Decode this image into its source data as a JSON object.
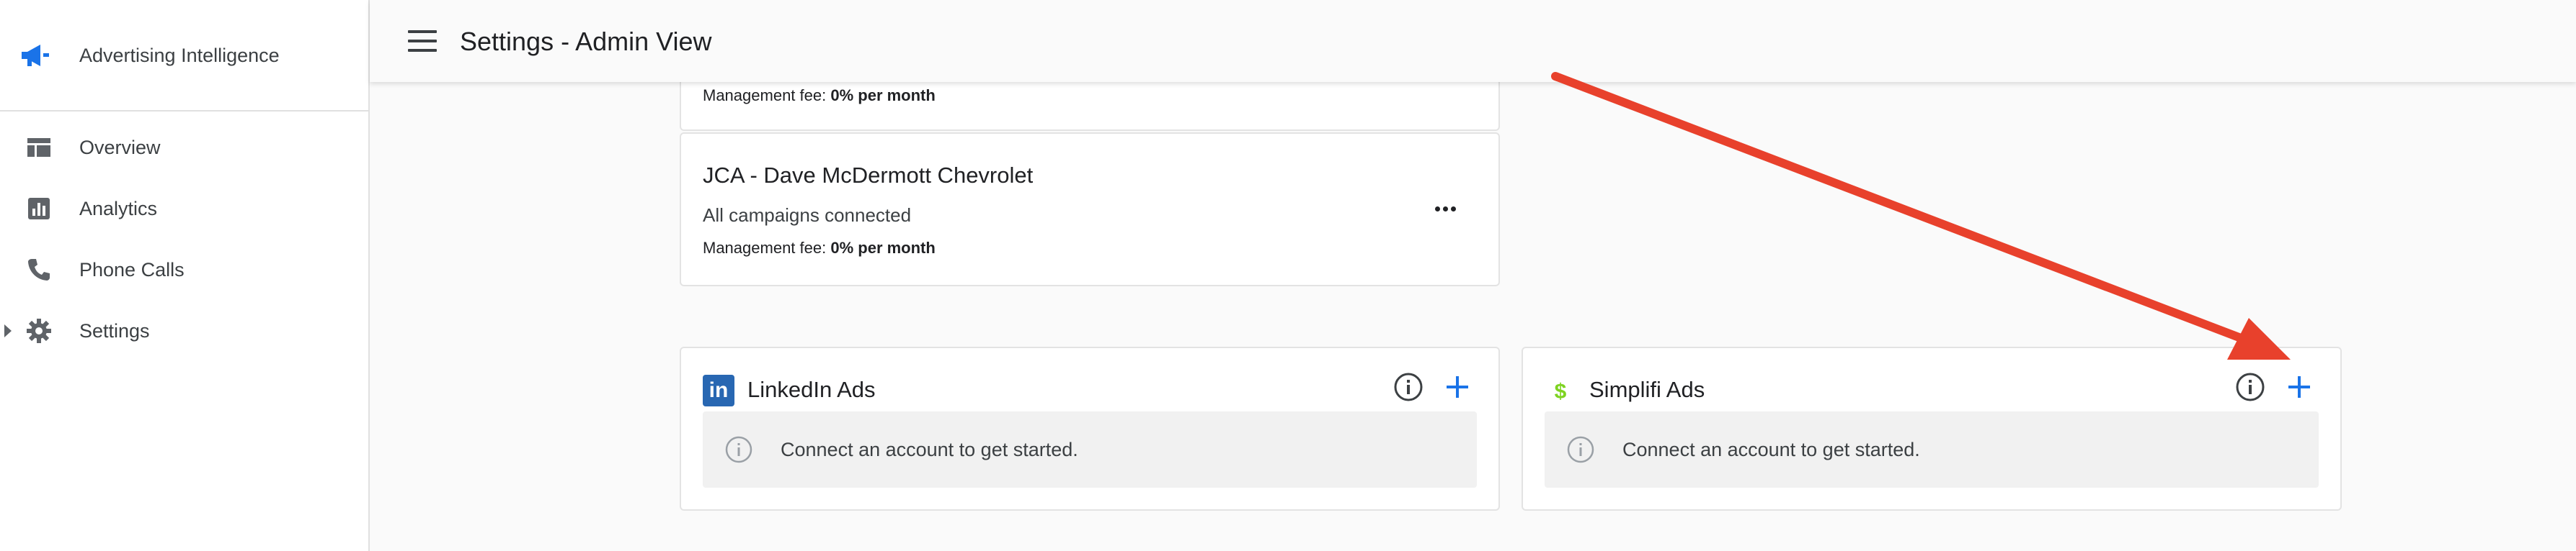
{
  "app": {
    "title": "Advertising Intelligence"
  },
  "header": {
    "title": "Settings - Admin View"
  },
  "sidebar": {
    "items": [
      {
        "label": "Overview",
        "icon": "dashboard-icon"
      },
      {
        "label": "Analytics",
        "icon": "analytics-icon"
      },
      {
        "label": "Phone Calls",
        "icon": "phone-icon"
      },
      {
        "label": "Settings",
        "icon": "gear-icon"
      }
    ]
  },
  "accounts": [
    {
      "fee_label": "Management fee:",
      "fee_value": "0% per month"
    },
    {
      "name": "JCA - Dave McDermott Chevrolet",
      "status": "All campaigns connected",
      "fee_label": "Management fee:",
      "fee_value": "0% per month"
    }
  ],
  "platforms": [
    {
      "name": "LinkedIn Ads",
      "empty_message": "Connect an account to get started.",
      "logo_text": "in"
    },
    {
      "name": "Simplifi Ads",
      "empty_message": "Connect an account to get started."
    }
  ],
  "colors": {
    "accent_blue": "#1a73e8",
    "linkedin_blue": "#2867b2",
    "simplifi_green": "#7ed321",
    "annotation_red": "#e8412c"
  }
}
